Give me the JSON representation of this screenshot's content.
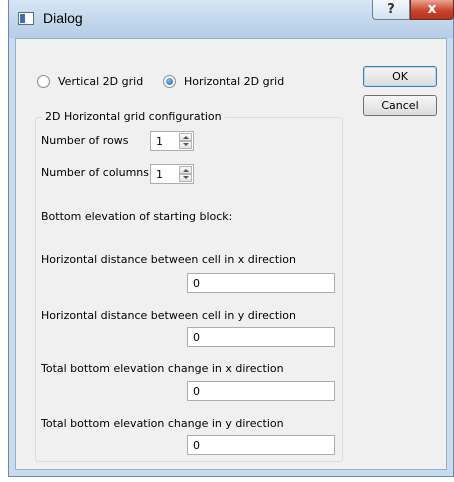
{
  "window": {
    "title": "Dialog",
    "help_glyph": "?",
    "close_glyph": "x"
  },
  "radios": {
    "vertical": {
      "label": "Vertical 2D grid",
      "selected": false
    },
    "horizontal": {
      "label": "Horizontal 2D grid",
      "selected": true
    }
  },
  "buttons": {
    "ok": "OK",
    "cancel": "Cancel"
  },
  "group": {
    "title": "2D Horizontal grid configuration",
    "rows_label": "Number of rows",
    "rows_value": "1",
    "cols_label": "Number of columns",
    "cols_value": "1",
    "bottom_elevation_label": "Bottom elevation of starting block:",
    "fields": [
      {
        "label": "Horizontal distance between cell in x direction",
        "value": "0"
      },
      {
        "label": "Horizontal distance between cell in y direction",
        "value": "0"
      },
      {
        "label": "Total bottom elevation change in x direction",
        "value": "0"
      },
      {
        "label": "Total bottom elevation change in y direction",
        "value": "0"
      }
    ]
  },
  "icons": [
    "window-icon",
    "help-icon",
    "close-icon",
    "spin-up-icon",
    "spin-down-icon"
  ]
}
